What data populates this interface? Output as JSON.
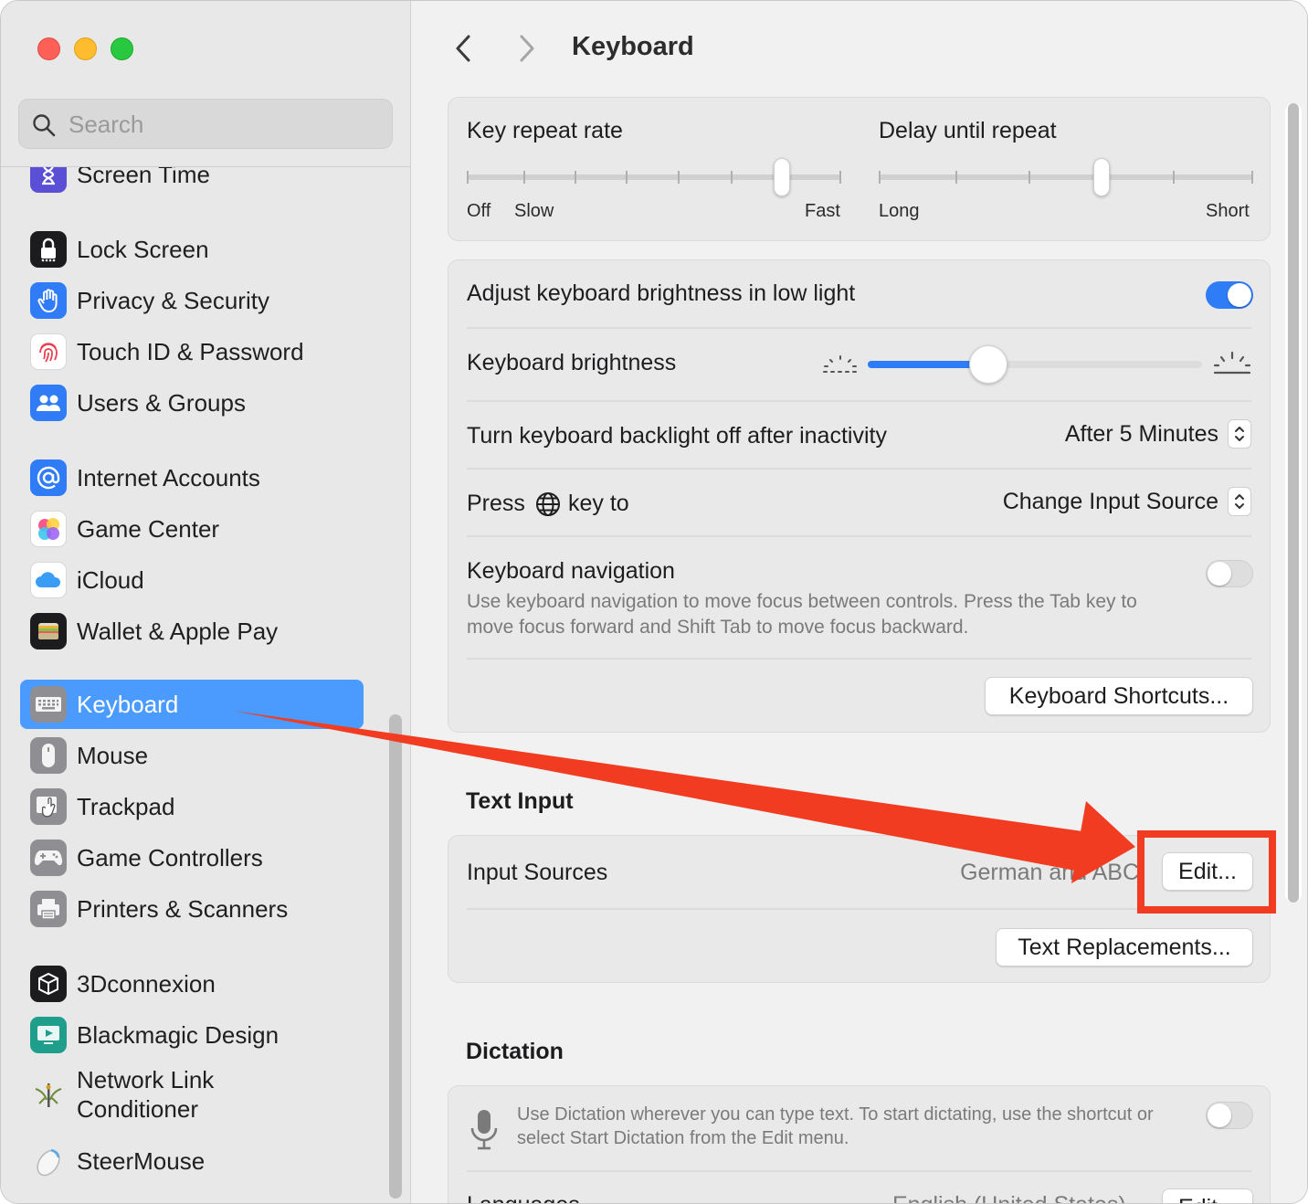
{
  "window": {
    "title": "Keyboard"
  },
  "sidebar": {
    "search_placeholder": "Search",
    "items": [
      {
        "label": "Screen Time",
        "icon": "hourglass-icon",
        "color": "#5b4fd6"
      },
      {
        "label": "Lock Screen",
        "icon": "lock-icon",
        "color": "#1c1c1e"
      },
      {
        "label": "Privacy & Security",
        "icon": "hand-icon",
        "color": "#2f7cf6"
      },
      {
        "label": "Touch ID & Password",
        "icon": "fingerprint-icon",
        "color": "#ffffff"
      },
      {
        "label": "Users & Groups",
        "icon": "users-icon",
        "color": "#2f7cf6"
      },
      {
        "label": "Internet Accounts",
        "icon": "at-icon",
        "color": "#2f7cf6"
      },
      {
        "label": "Game Center",
        "icon": "game-center-icon",
        "color": "#ffffff"
      },
      {
        "label": "iCloud",
        "icon": "cloud-icon",
        "color": "#ffffff"
      },
      {
        "label": "Wallet & Apple Pay",
        "icon": "wallet-icon",
        "color": "#1c1c1e"
      },
      {
        "label": "Keyboard",
        "icon": "keyboard-icon",
        "color": "#8e8e93",
        "selected": true
      },
      {
        "label": "Mouse",
        "icon": "mouse-icon",
        "color": "#8e8e93"
      },
      {
        "label": "Trackpad",
        "icon": "trackpad-icon",
        "color": "#8e8e93"
      },
      {
        "label": "Game Controllers",
        "icon": "gamepad-icon",
        "color": "#8e8e93"
      },
      {
        "label": "Printers & Scanners",
        "icon": "printer-icon",
        "color": "#8e8e93"
      },
      {
        "label": "3Dconnexion",
        "icon": "3dconnexion-icon",
        "color": "#1c1c1e"
      },
      {
        "label": "Blackmagic Design",
        "icon": "blackmagic-icon",
        "color": "#1f9e8c"
      },
      {
        "label": "Network Link Conditioner",
        "icon": "network-link-icon",
        "color": "#e8e8e8"
      },
      {
        "label": "SteerMouse",
        "icon": "steermouse-icon",
        "color": "#ffffff"
      }
    ]
  },
  "main": {
    "title": "Keyboard",
    "repeat": {
      "key_repeat_label": "Key repeat rate",
      "key_repeat_min_labels": [
        "Off",
        "Slow"
      ],
      "key_repeat_max_label": "Fast",
      "key_repeat_value": 6,
      "key_repeat_steps": 8,
      "delay_label": "Delay until repeat",
      "delay_min_label": "Long",
      "delay_max_label": "Short",
      "delay_value": 3,
      "delay_steps": 6
    },
    "adjust_brightness": {
      "label": "Adjust keyboard brightness in low light",
      "on": true
    },
    "brightness": {
      "label": "Keyboard brightness",
      "value": 0.36
    },
    "backlight_off": {
      "label": "Turn keyboard backlight off after inactivity",
      "value": "After 5 Minutes"
    },
    "globe_key": {
      "label_before": "Press",
      "label_after": "key to",
      "value": "Change Input Source"
    },
    "keyboard_navigation": {
      "label": "Keyboard navigation",
      "description": "Use keyboard navigation to move focus between controls. Press the Tab key to move focus forward and Shift Tab to move focus backward.",
      "on": false
    },
    "shortcuts_button": "Keyboard Shortcuts...",
    "text_input": {
      "section_title": "Text Input",
      "input_sources_label": "Input Sources",
      "input_sources_value": "German and ABC",
      "edit_button": "Edit...",
      "text_replacements_button": "Text Replacements..."
    },
    "dictation": {
      "section_title": "Dictation",
      "description": "Use Dictation wherever you can type text. To start dictating, use the shortcut or select Start Dictation from the Edit menu.",
      "on": false,
      "language_label": "Languages",
      "language_value": "English (United States)",
      "edit_button": "Edit..."
    }
  },
  "annotation": {
    "color": "#f13c21",
    "target": "Edit..."
  }
}
